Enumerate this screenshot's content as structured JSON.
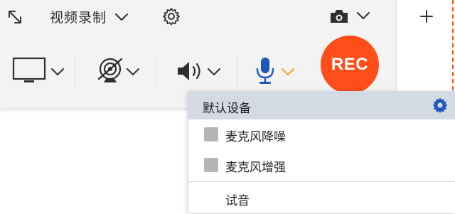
{
  "toolbar": {
    "title": "视频录制",
    "rec_label": "REC",
    "icons": {
      "resize": "expand-arrows-icon",
      "settings": "gear-icon",
      "camera": "camera-icon",
      "add": "plus-icon",
      "screen": "monitor-icon",
      "webcam": "webcam-off-icon",
      "speaker": "speaker-icon",
      "mic": "microphone-icon"
    }
  },
  "mic_menu": {
    "header": "默认设备",
    "items": [
      {
        "label": "麦克风降噪",
        "checked": false
      },
      {
        "label": "麦克风增强",
        "checked": false
      }
    ],
    "test_label": "试音"
  },
  "colors": {
    "accent_blue": "#1e57b9",
    "rec_orange": "#ff4e19",
    "chevron_active": "#f5a623"
  }
}
